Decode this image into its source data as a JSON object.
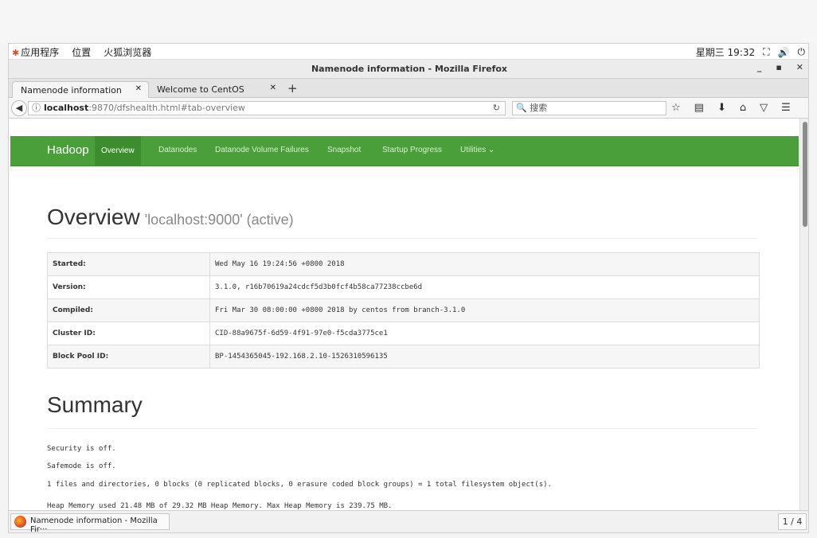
{
  "gnome": {
    "apps": "应用程序",
    "places": "位置",
    "browser": "火狐浏览器",
    "clock": "星期三 19:32"
  },
  "window": {
    "title": "Namenode information - Mozilla Firefox"
  },
  "tabs": [
    {
      "label": "Namenode information"
    },
    {
      "label": "Welcome to CentOS"
    }
  ],
  "urlbar": {
    "host": "localhost",
    "rest": ":9870/dfshealth.html#tab-overview"
  },
  "search": {
    "placeholder": "搜索"
  },
  "hadoop_nav": {
    "brand": "Hadoop",
    "items": [
      "Overview",
      "Datanodes",
      "Datanode Volume Failures",
      "Snapshot",
      "Startup Progress",
      "Utilities ⌄"
    ]
  },
  "overview": {
    "title": "Overview",
    "subtitle": "'localhost:9000' (active)",
    "rows": [
      {
        "key": "Started:",
        "value": "Wed May 16 19:24:56 +0800 2018"
      },
      {
        "key": "Version:",
        "value": "3.1.0, r16b70619a24cdcf5d3b0fcf4b58ca77238ccbe6d"
      },
      {
        "key": "Compiled:",
        "value": "Fri Mar 30 08:00:00 +0800 2018 by centos from branch-3.1.0"
      },
      {
        "key": "Cluster ID:",
        "value": "CID-88a9675f-6d59-4f91-97e0-f5cda3775ce1"
      },
      {
        "key": "Block Pool ID:",
        "value": "BP-1454365045-192.168.2.10-1526310596135"
      }
    ]
  },
  "summary": {
    "title": "Summary",
    "lines": [
      "Security is off.",
      "Safemode is off.",
      "1 files and directories, 0 blocks (0 replicated blocks, 0 erasure coded block groups) = 1 total filesystem object(s).",
      "Heap Memory used 21.48 MB of 29.32 MB Heap Memory. Max Heap Memory is 239.75 MB."
    ]
  },
  "taskbar": {
    "task": "Namenode information - Mozilla Fir···",
    "pager": "1 / 4"
  }
}
